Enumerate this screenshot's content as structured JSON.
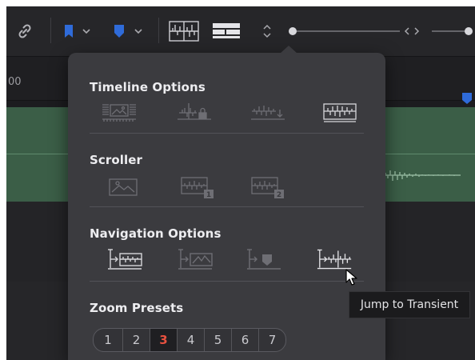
{
  "ruler": {
    "label": "00"
  },
  "popover": {
    "sections": [
      {
        "title": "Timeline Options",
        "options": [
          "filmstrip-view-icon",
          "waveform-lock-icon",
          "waveform-arrow-icon",
          "waveform-full-icon"
        ],
        "selected": "waveform-full-icon"
      },
      {
        "title": "Scroller",
        "options": [
          "scroller-image-icon",
          "scroller-waveform-1-icon",
          "scroller-waveform-2-icon"
        ]
      },
      {
        "title": "Navigation Options",
        "options": [
          "jump-to-clip-icon",
          "jump-to-waveform-icon",
          "jump-to-marker-icon",
          "jump-to-transient-icon"
        ],
        "selected_hovered": "jump-to-transient-icon"
      },
      {
        "title": "Zoom Presets"
      }
    ],
    "zoom_presets": [
      "1",
      "2",
      "3",
      "4",
      "5",
      "6",
      "7"
    ],
    "zoom_active": "3"
  },
  "tooltip": {
    "text": "Jump to Transient"
  },
  "colors": {
    "marker_blue": "#2f6bd9",
    "zoom_active": "#e8513f",
    "track_green": "#3b5e47"
  }
}
